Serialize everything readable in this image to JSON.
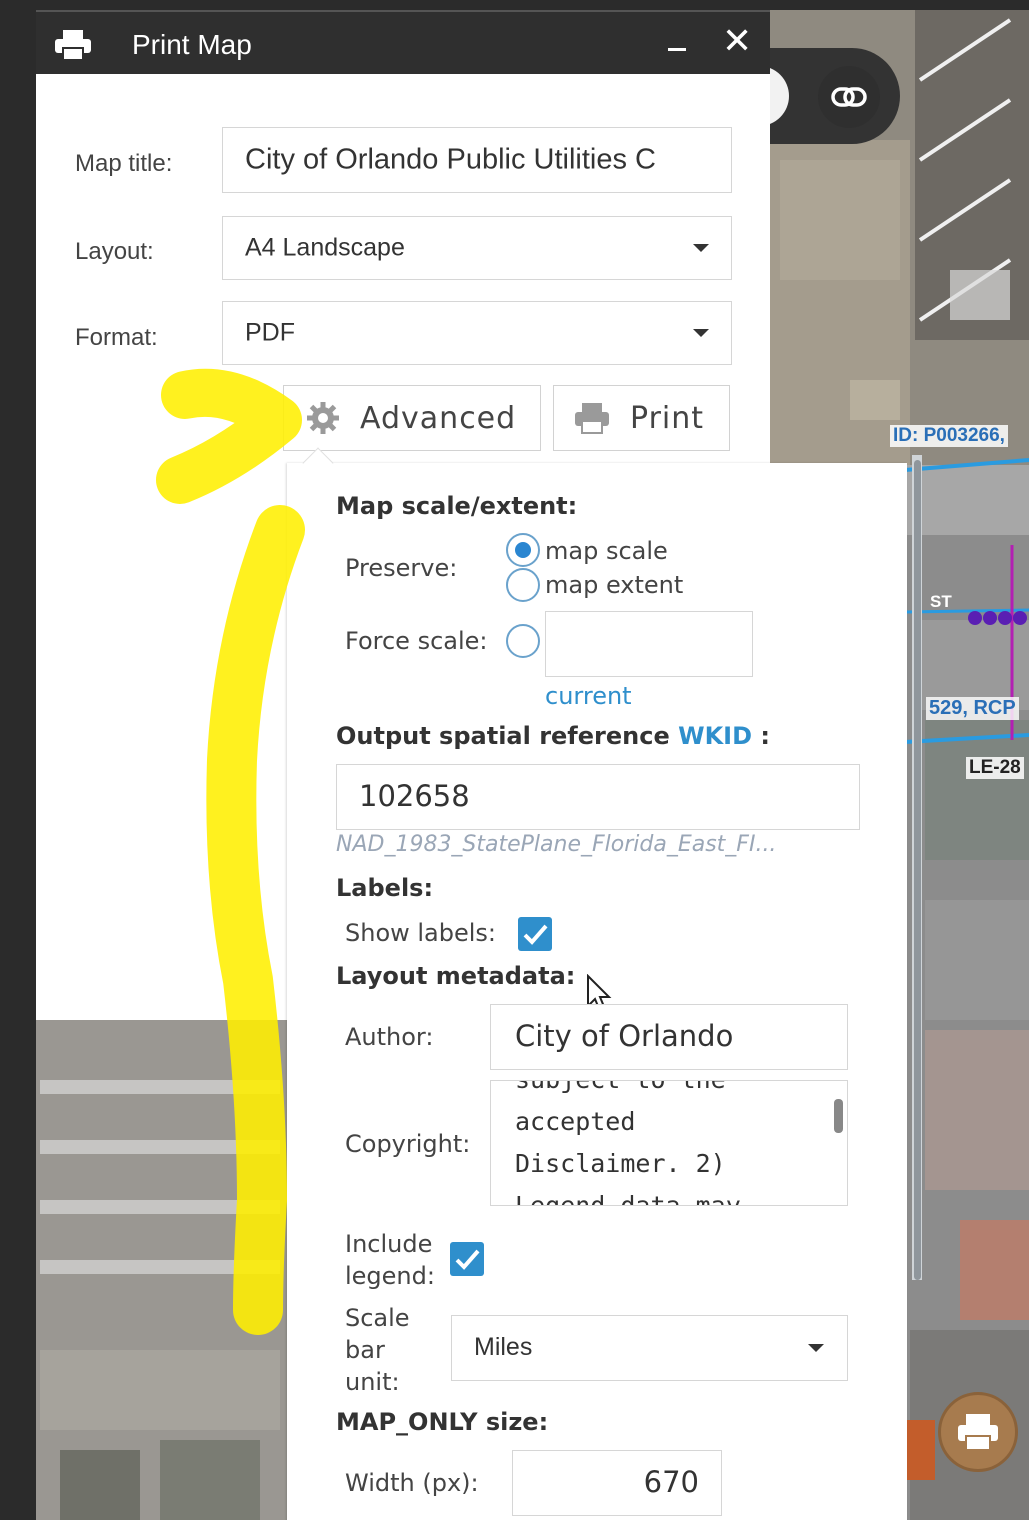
{
  "window": {
    "title": "Print Map"
  },
  "form": {
    "map_title_label": "Map title:",
    "map_title_value": "City of Orlando Public Utilities C",
    "layout_label": "Layout:",
    "layout_value": "A4 Landscape",
    "format_label": "Format:",
    "format_value": "PDF"
  },
  "buttons": {
    "advanced": "Advanced",
    "print": "Print"
  },
  "advanced": {
    "scale_extent_heading": "Map scale/extent:",
    "preserve_label": "Preserve:",
    "preserve_options": [
      "map scale",
      "map extent"
    ],
    "preserve_selected": "map scale",
    "force_scale_label": "Force scale:",
    "force_scale_value": "",
    "current_link": "current",
    "output_sr_heading": "Output spatial reference",
    "wkid_link": "WKID",
    "output_sr_suffix": " :",
    "wkid_value": "102658",
    "wkid_description": "NAD_1983_StatePlane_Florida_East_FI...",
    "labels_heading": "Labels:",
    "show_labels_label": "Show labels:",
    "show_labels_checked": true,
    "layout_metadata_heading": "Layout metadata:",
    "author_label": "Author:",
    "author_value": "City of Orlando",
    "copyright_label": "Copyright:",
    "copyright_lines": [
      "subject to the",
      "accepted",
      "Disclaimer. 2)",
      "Legend data may"
    ],
    "include_legend_label_1": "Include",
    "include_legend_label_2": "legend:",
    "include_legend_checked": true,
    "scale_bar_label_1": "Scale",
    "scale_bar_label_2": "bar",
    "scale_bar_label_3": "unit:",
    "scale_bar_value": "Miles",
    "map_only_heading": "MAP_ONLY size:",
    "width_label": "Width (px):",
    "width_value": "670"
  },
  "map": {
    "label_id": "ID: P003266,",
    "label_529": "529, RCP",
    "label_le": "LE-28",
    "label_st": "ST"
  },
  "colors": {
    "accent_blue": "#2f8fcc",
    "titlebar": "#2f2f2f",
    "annotation_yellow": "#ffef00",
    "print_fab": "#a77b4e"
  }
}
